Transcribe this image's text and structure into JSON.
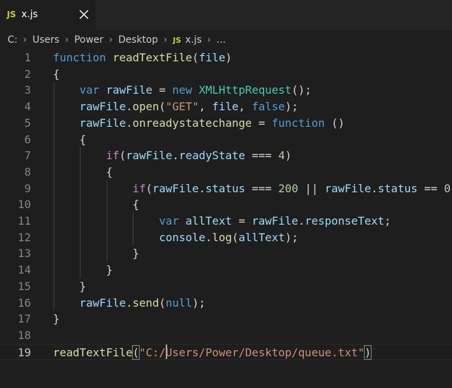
{
  "tab": {
    "badge": "JS",
    "label": "x.js",
    "close_glyph": "✕"
  },
  "breadcrumb": {
    "items": [
      "C:",
      "Users",
      "Power",
      "Desktop"
    ],
    "file_badge": "JS",
    "file": "x.js",
    "more": "...",
    "separator": "›"
  },
  "editor": {
    "language": "javascript",
    "current_line": 19,
    "lines": [
      {
        "n": "1",
        "tokens": [
          [
            "keyword",
            "function "
          ],
          [
            "func",
            "readTextFile"
          ],
          [
            "punct",
            "("
          ],
          [
            "var",
            "file"
          ],
          [
            "punct",
            ")"
          ]
        ]
      },
      {
        "n": "2",
        "tokens": [
          [
            "punct",
            "{"
          ]
        ]
      },
      {
        "n": "3",
        "tokens": [
          [
            "punct",
            "    "
          ],
          [
            "keyword",
            "var "
          ],
          [
            "var",
            "rawFile"
          ],
          [
            "punct",
            " = "
          ],
          [
            "keyword",
            "new "
          ],
          [
            "class",
            "XMLHttpRequest"
          ],
          [
            "punct",
            "();"
          ]
        ]
      },
      {
        "n": "4",
        "tokens": [
          [
            "punct",
            "    "
          ],
          [
            "var",
            "rawFile"
          ],
          [
            "punct",
            "."
          ],
          [
            "func",
            "open"
          ],
          [
            "punct",
            "("
          ],
          [
            "string",
            "\"GET\""
          ],
          [
            "punct",
            ", "
          ],
          [
            "var",
            "file"
          ],
          [
            "punct",
            ", "
          ],
          [
            "keyword",
            "false"
          ],
          [
            "punct",
            ");"
          ]
        ]
      },
      {
        "n": "5",
        "tokens": [
          [
            "punct",
            "    "
          ],
          [
            "var",
            "rawFile"
          ],
          [
            "punct",
            "."
          ],
          [
            "func",
            "onreadystatechange"
          ],
          [
            "punct",
            " = "
          ],
          [
            "keyword",
            "function "
          ],
          [
            "punct",
            "()"
          ]
        ]
      },
      {
        "n": "6",
        "tokens": [
          [
            "punct",
            "    {"
          ]
        ]
      },
      {
        "n": "7",
        "tokens": [
          [
            "punct",
            "        "
          ],
          [
            "control",
            "if"
          ],
          [
            "punct",
            "("
          ],
          [
            "var",
            "rawFile"
          ],
          [
            "punct",
            "."
          ],
          [
            "var",
            "readyState"
          ],
          [
            "punct",
            " === "
          ],
          [
            "number",
            "4"
          ],
          [
            "punct",
            ")"
          ]
        ]
      },
      {
        "n": "8",
        "tokens": [
          [
            "punct",
            "        {"
          ]
        ]
      },
      {
        "n": "9",
        "tokens": [
          [
            "punct",
            "            "
          ],
          [
            "control",
            "if"
          ],
          [
            "punct",
            "("
          ],
          [
            "var",
            "rawFile"
          ],
          [
            "punct",
            "."
          ],
          [
            "var",
            "status"
          ],
          [
            "punct",
            " === "
          ],
          [
            "number",
            "200"
          ],
          [
            "punct",
            " || "
          ],
          [
            "var",
            "rawFile"
          ],
          [
            "punct",
            "."
          ],
          [
            "var",
            "status"
          ],
          [
            "punct",
            " == "
          ],
          [
            "number",
            "0"
          ],
          [
            "punct",
            ")"
          ]
        ]
      },
      {
        "n": "10",
        "tokens": [
          [
            "punct",
            "            {"
          ]
        ]
      },
      {
        "n": "11",
        "tokens": [
          [
            "punct",
            "                "
          ],
          [
            "keyword",
            "var "
          ],
          [
            "var",
            "allText"
          ],
          [
            "punct",
            " = "
          ],
          [
            "var",
            "rawFile"
          ],
          [
            "punct",
            "."
          ],
          [
            "var",
            "responseText"
          ],
          [
            "punct",
            ";"
          ]
        ]
      },
      {
        "n": "12",
        "tokens": [
          [
            "punct",
            "                "
          ],
          [
            "var",
            "console"
          ],
          [
            "punct",
            "."
          ],
          [
            "func",
            "log"
          ],
          [
            "punct",
            "("
          ],
          [
            "var",
            "allText"
          ],
          [
            "punct",
            ");"
          ]
        ]
      },
      {
        "n": "13",
        "tokens": [
          [
            "punct",
            "            }"
          ]
        ]
      },
      {
        "n": "14",
        "tokens": [
          [
            "punct",
            "        }"
          ]
        ]
      },
      {
        "n": "15",
        "tokens": [
          [
            "punct",
            "    }"
          ]
        ]
      },
      {
        "n": "16",
        "tokens": [
          [
            "punct",
            "    "
          ],
          [
            "var",
            "rawFile"
          ],
          [
            "punct",
            "."
          ],
          [
            "func",
            "send"
          ],
          [
            "punct",
            "("
          ],
          [
            "keyword",
            "null"
          ],
          [
            "punct",
            ");"
          ]
        ]
      },
      {
        "n": "17",
        "tokens": [
          [
            "punct",
            "}"
          ]
        ]
      },
      {
        "n": "18",
        "tokens": []
      },
      {
        "n": "19",
        "tokens": [
          [
            "func",
            "readTextFile"
          ],
          [
            "bracket",
            "("
          ],
          [
            "string",
            "\"C:/Users/Power/Desktop/queue.txt\""
          ],
          [
            "bracket",
            ")"
          ]
        ]
      }
    ]
  },
  "colors": {
    "background": "#1e1e1e",
    "tabbar": "#252526",
    "keyword": "#569cd6",
    "control": "#c586c0",
    "function": "#dcdcaa",
    "variable": "#9cdcfe",
    "class": "#4ec9b0",
    "string": "#ce9178",
    "number": "#b5cea8",
    "js_badge": "#cbcb41"
  },
  "icons": {
    "tab_file_icon": "js-file-icon",
    "close": "close-icon",
    "breadcrumb_separator": "chevron-right-icon"
  }
}
